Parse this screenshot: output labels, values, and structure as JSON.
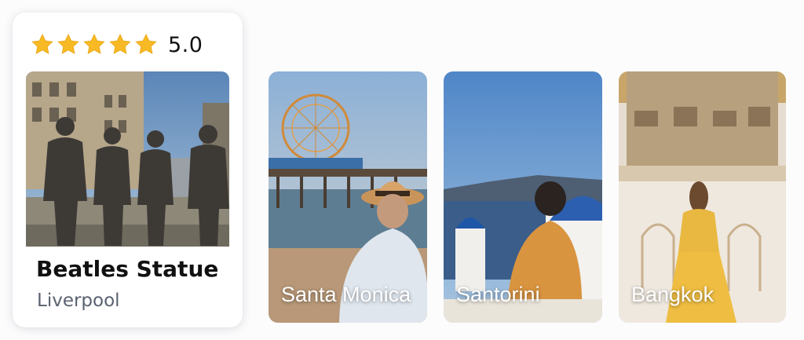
{
  "featured": {
    "rating": {
      "stars": 5,
      "value": "5.0",
      "star_color": "#f7b924"
    },
    "photo_icon": "statue-photo",
    "title": "Beatles Statue",
    "subtitle": "Liverpool"
  },
  "destinations": [
    {
      "label": "Santa Monica",
      "photo_icon": "pier-photo"
    },
    {
      "label": "Santorini",
      "photo_icon": "island-photo"
    },
    {
      "label": "Bangkok",
      "photo_icon": "temple-photo"
    }
  ]
}
